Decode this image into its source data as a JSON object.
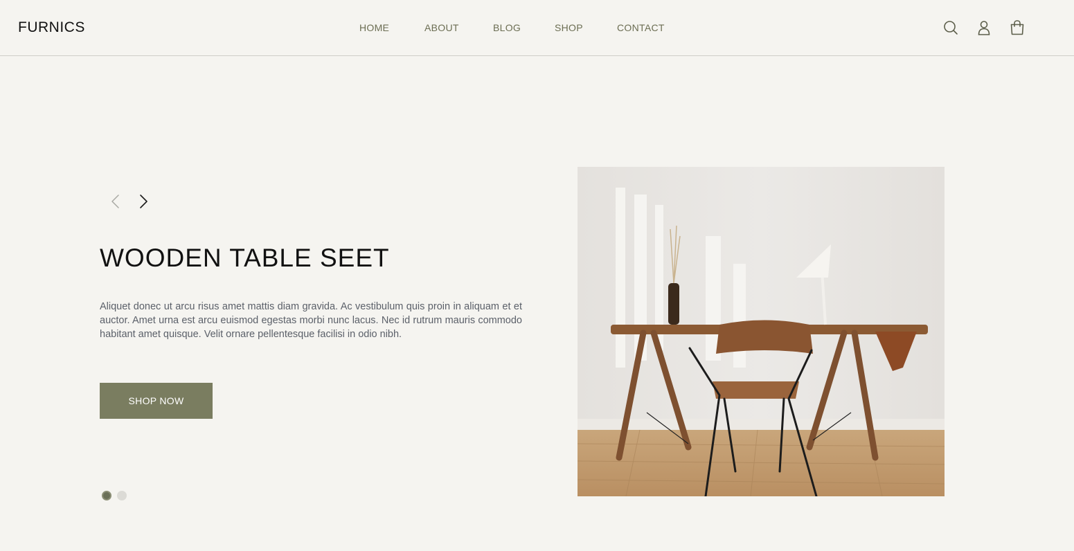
{
  "brand": {
    "logo": "FURNICS"
  },
  "nav": {
    "items": [
      {
        "label": "HOME"
      },
      {
        "label": "ABOUT"
      },
      {
        "label": "BLOG"
      },
      {
        "label": "SHOP"
      },
      {
        "label": "CONTACT"
      }
    ]
  },
  "header_icons": [
    "search-icon",
    "user-icon",
    "shopping-bag-icon"
  ],
  "hero": {
    "title": "WOODEN TABLE SEET",
    "description": "Aliquet donec ut arcu risus amet mattis diam gravida. Ac vestibulum quis proin in aliquam et et auctor. Amet urna est arcu euismod egestas morbi nunc lacus. Nec id rutrum mauris commodo habitant amet quisque. Velit ornare pellentesque facilisi in odio nibh.",
    "button_label": "SHOP NOW",
    "slides": {
      "current": 1,
      "total": 2
    }
  },
  "colors": {
    "background": "#f5f4f0",
    "accent": "#7a7d60",
    "nav_text": "#6b6d52"
  }
}
